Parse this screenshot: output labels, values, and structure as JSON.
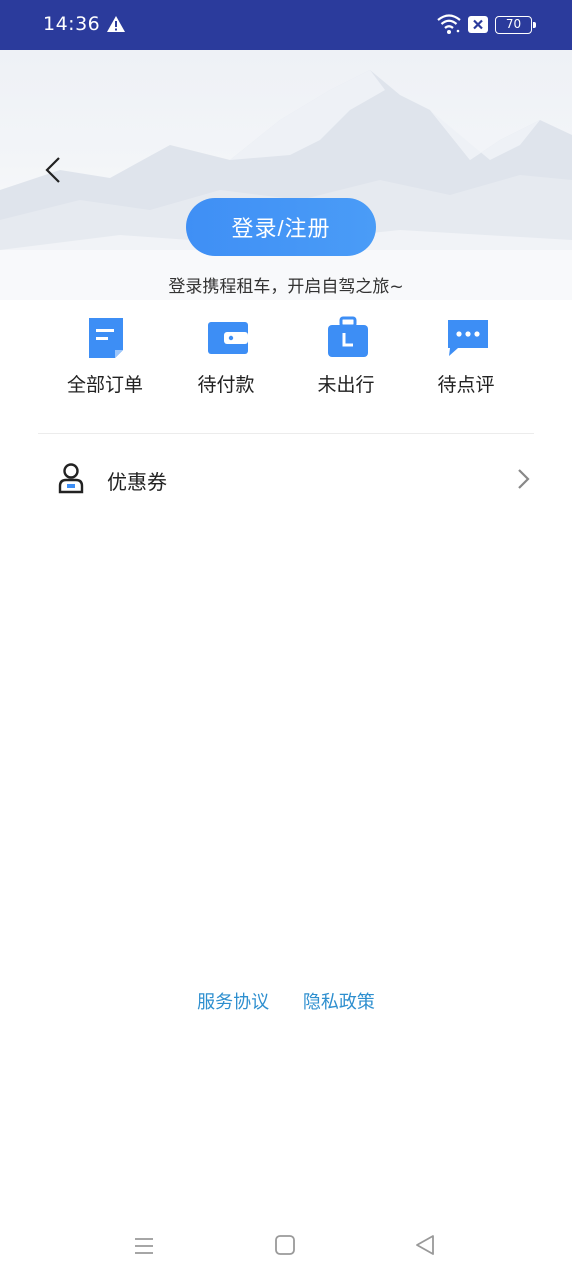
{
  "status_bar": {
    "time": "14:36",
    "battery": "70",
    "icons": [
      "warning-icon",
      "wifi-icon",
      "sim-icon",
      "battery-icon"
    ]
  },
  "header": {
    "login_button": "登录/注册",
    "subtitle": "登录携程租车，开启自驾之旅~"
  },
  "quick_actions": [
    {
      "label": "全部订单",
      "icon": "document-icon"
    },
    {
      "label": "待付款",
      "icon": "wallet-icon"
    },
    {
      "label": "未出行",
      "icon": "suitcase-icon"
    },
    {
      "label": "待点评",
      "icon": "chat-icon"
    }
  ],
  "menu": {
    "coupon_label": "优惠券",
    "coupon_icon": "user-icon"
  },
  "footer": {
    "service_agreement": "服务协议",
    "privacy_policy": "隐私政策"
  },
  "colors": {
    "status_bar": "#2b3b9c",
    "accent": "#4a9cf7",
    "link": "#2e8fcf"
  }
}
